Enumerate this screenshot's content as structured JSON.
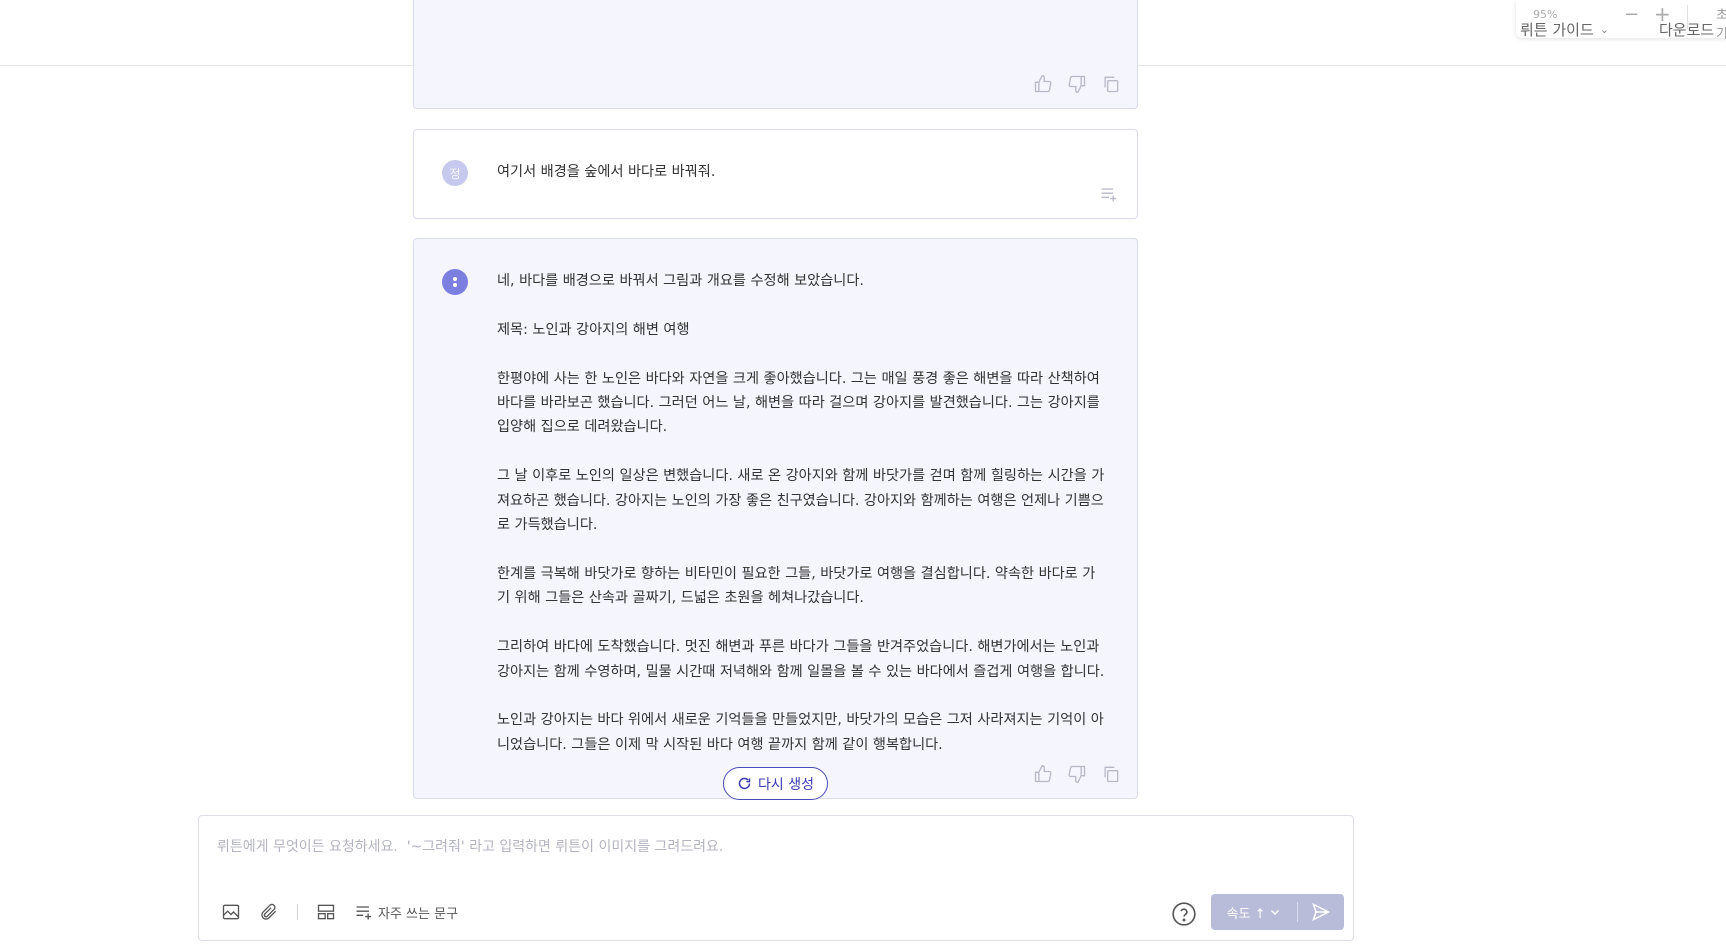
{
  "zoom": {
    "percent": "95%",
    "guide_label": "뤼튼 가이드",
    "minus_label": "−",
    "plus_label": "+",
    "download_label": "다운로드",
    "reset_label": "초기"
  },
  "messages": {
    "user": {
      "avatar": "정",
      "text": "여기서 배경을 숲에서 바다로 바꿔줘."
    },
    "ai": {
      "text": "네, 바다를 배경으로 바꿔서 그림과 개요를 수정해 보았습니다.\n\n제목: 노인과 강아지의 해변 여행\n\n한평야에 사는 한 노인은 바다와 자연을 크게 좋아했습니다. 그는 매일 풍경 좋은 해변을 따라 산책하여\n바다를 바라보곤 했습니다. 그러던 어느 날, 해변을 따라 걸으며 강아지를 발견했습니다. 그는 강아지를\n입양해 집으로 데려왔습니다.\n\n그 날 이후로 노인의 일상은 변했습니다. 새로 온 강아지와 함께 바닷가를 걷며 함께 힐링하는 시간을 가\n져요하곤 했습니다. 강아지는 노인의 가장 좋은 친구였습니다. 강아지와 함께하는 여행은 언제나 기쁨으\n로 가득했습니다.\n\n한계를 극복해 바닷가로 향하는 비타민이 필요한 그들, 바닷가로 여행을 결심합니다. 약속한 바다로 가\n기 위해 그들은 산속과 골짜기, 드넓은 초원을 헤쳐나갔습니다.\n\n그리하여 바다에 도착했습니다. 멋진 해변과 푸른 바다가 그들을 반겨주었습니다. 해변가에서는 노인과\n강아지는 함께 수영하며, 밀물 시간때 저녁해와 함께 일몰을 볼 수 있는 바다에서 즐겁게 여행을 합니다.\n\n노인과 강아지는 바다 위에서 새로운 기억들을 만들었지만, 바닷가의 모습은 그저 사라져지는 기억이 아\n니었습니다. 그들은 이제 막 시작된 바다 여행 끝까지 함께 같이 행복합니다."
    }
  },
  "regenerate_label": "다시 생성",
  "composer": {
    "placeholder": "뤼튼에게 무엇이든 요청하세요.  '~그려줘' 라고 입력하면 뤼튼이 이미지를 그려드려요.",
    "phrase_label": "자주 쓰는 문구",
    "speed_label": "속도 ↑"
  },
  "colors": {
    "accent": "#3b3bb0",
    "ai_bg": "#f4f5fd",
    "send_bg": "#b9bcd8"
  },
  "icons": [
    "thumbs-up-icon",
    "thumbs-down-icon",
    "copy-icon",
    "add-note-icon",
    "refresh-icon",
    "image-icon",
    "paperclip-icon",
    "layout-icon",
    "list-add-icon",
    "help-icon",
    "chevron-down-icon",
    "send-icon"
  ]
}
